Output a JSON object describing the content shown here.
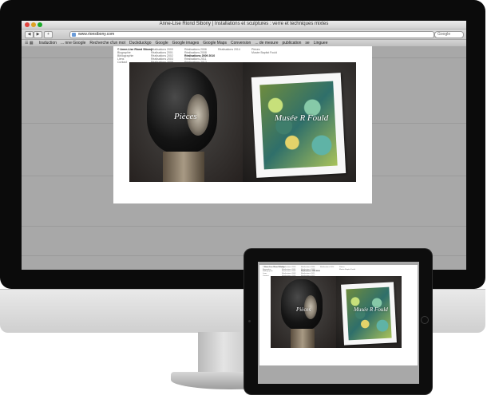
{
  "browser": {
    "window_title": "Anne-Lise Riond Sibony | Installations et sculptures : verre et techniques mixtes",
    "url": "www.rionsibony.com",
    "search_placeholder": "Google",
    "bookmarks": [
      "traduction",
      "... nne Google",
      "Recherche d'un mot",
      "Duckduckgo",
      "Google",
      "Google images",
      "Google Maps",
      "Conversion",
      "... de mesure",
      "publication",
      "se",
      "Linguee"
    ]
  },
  "site": {
    "nav_columns": [
      [
        "© Anne-Lise Riond Sibony",
        "Biographie",
        "Bibliographie",
        "Liens",
        "Contact"
      ],
      [
        "Réalisations 2000",
        "Réalisations 2001",
        "Réalisations 2002",
        "Réalisations 2003",
        "Réalisations 2005"
      ],
      [
        "Réalisations 2006",
        "Réalisations 2008",
        "Réalisations 2009 2010",
        "Réalisations 2011",
        "Réalisations 2012"
      ],
      [
        "Réalisations 2014"
      ],
      [
        "Pièces",
        "Musée Baptist Fould"
      ]
    ],
    "tiles": [
      {
        "caption": "Pièces"
      },
      {
        "caption": "Musée R Fould"
      }
    ]
  },
  "colors": {
    "bezel": "#0b0b0b",
    "browser_background": "#a8a8a8",
    "page_background": "#ffffff"
  }
}
